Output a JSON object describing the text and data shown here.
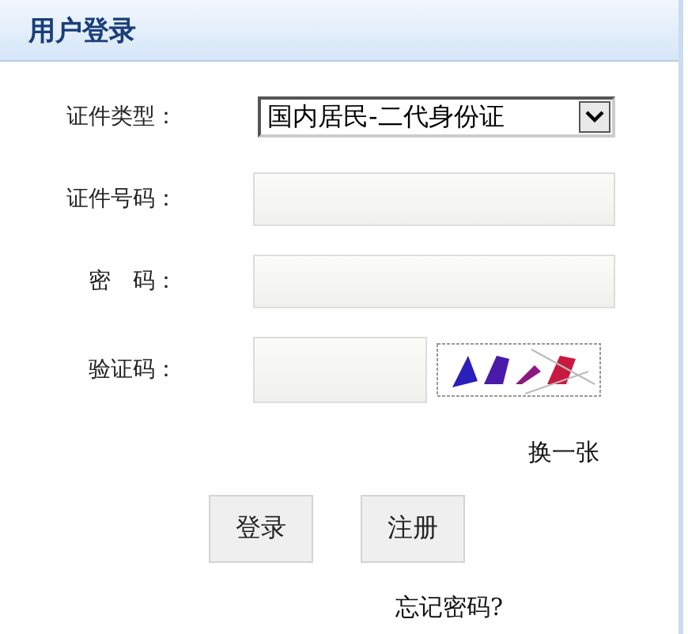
{
  "header": {
    "title": "用户登录"
  },
  "fields": [
    {
      "kind": "select",
      "label": "证件类型：",
      "value": "国内居民-二代身份证"
    },
    {
      "kind": "input",
      "label": "证件号码："
    },
    {
      "kind": "input",
      "label": "密　码："
    },
    {
      "kind": "captcha",
      "label": "验证码："
    }
  ],
  "refresh_link": "换一张",
  "buttons": [
    "登录",
    "注册"
  ],
  "forgot_link": "忘记密码?"
}
